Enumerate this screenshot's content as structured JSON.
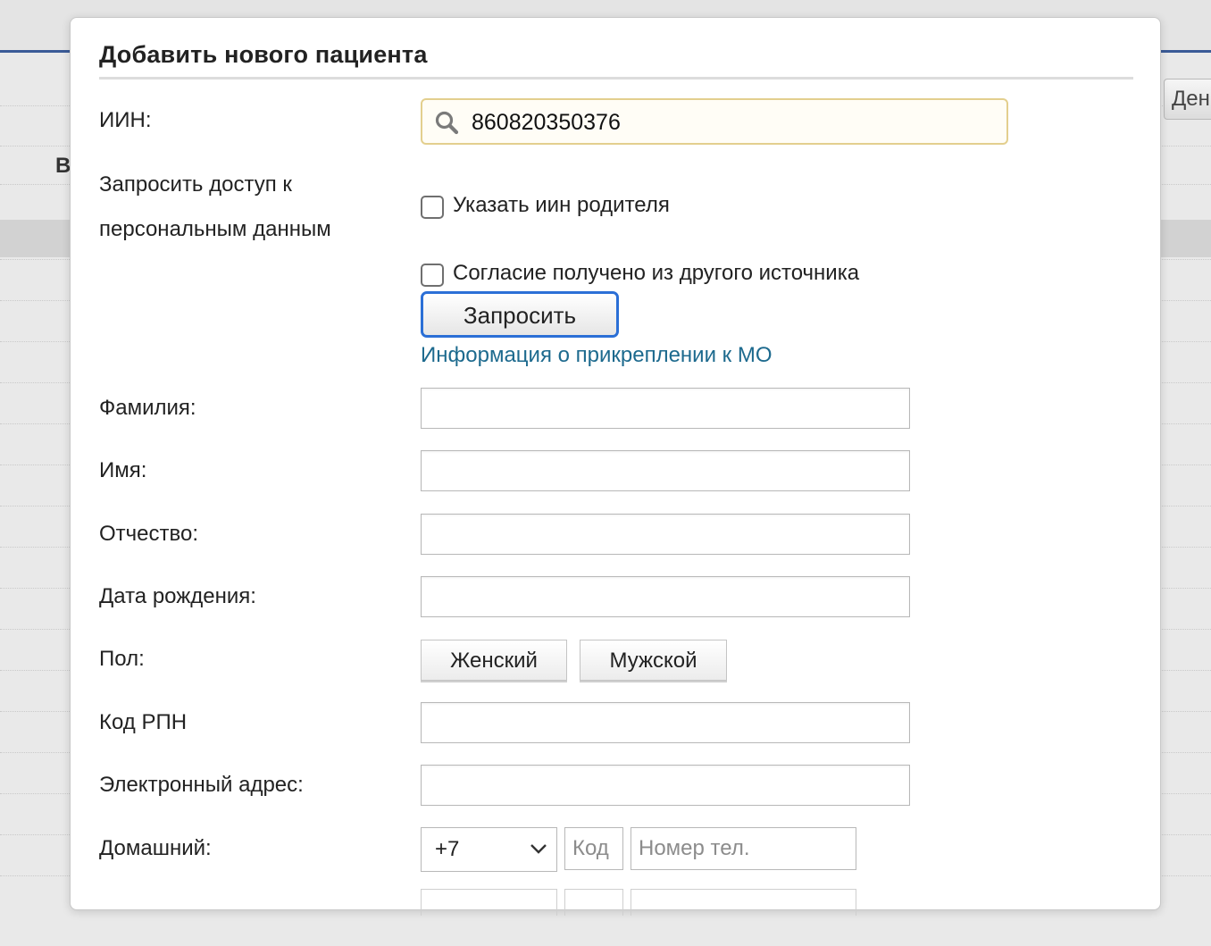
{
  "background": {
    "left_letter": "В",
    "right_button_label": "Ден"
  },
  "modal": {
    "title": "Добавить нового пациента",
    "iin": {
      "label": "ИИН:",
      "value": "860820350376"
    },
    "consent": {
      "label_line1": "Запросить доступ к",
      "label_line2": "персональным данным",
      "parent_iin_checkbox": {
        "label": "Указать иин родителя",
        "checked": false
      },
      "other_source_checkbox": {
        "label": "Согласие получено из другого источника",
        "checked": false
      },
      "request_button": "Запросить",
      "mo_link": "Информация о прикреплении к МО"
    },
    "fields": {
      "last_name_label": "Фамилия:",
      "first_name_label": "Имя:",
      "middle_name_label": "Отчество:",
      "birth_date_label": "Дата рождения:",
      "gender_label": "Пол:",
      "rpn_code_label": "Код РПН",
      "email_label": "Электронный адрес:",
      "home_phone_label": "Домашний:"
    },
    "gender_options": {
      "female": "Женский",
      "male": "Мужской"
    },
    "phone": {
      "country_code": "+7",
      "code_placeholder": "Код",
      "number_placeholder": "Номер тел."
    }
  },
  "colors": {
    "accent_blue": "#2b6fd6",
    "link_color": "#1d6a8e",
    "iin_border": "#e3cf8e",
    "header_line": "#3b5b97"
  }
}
